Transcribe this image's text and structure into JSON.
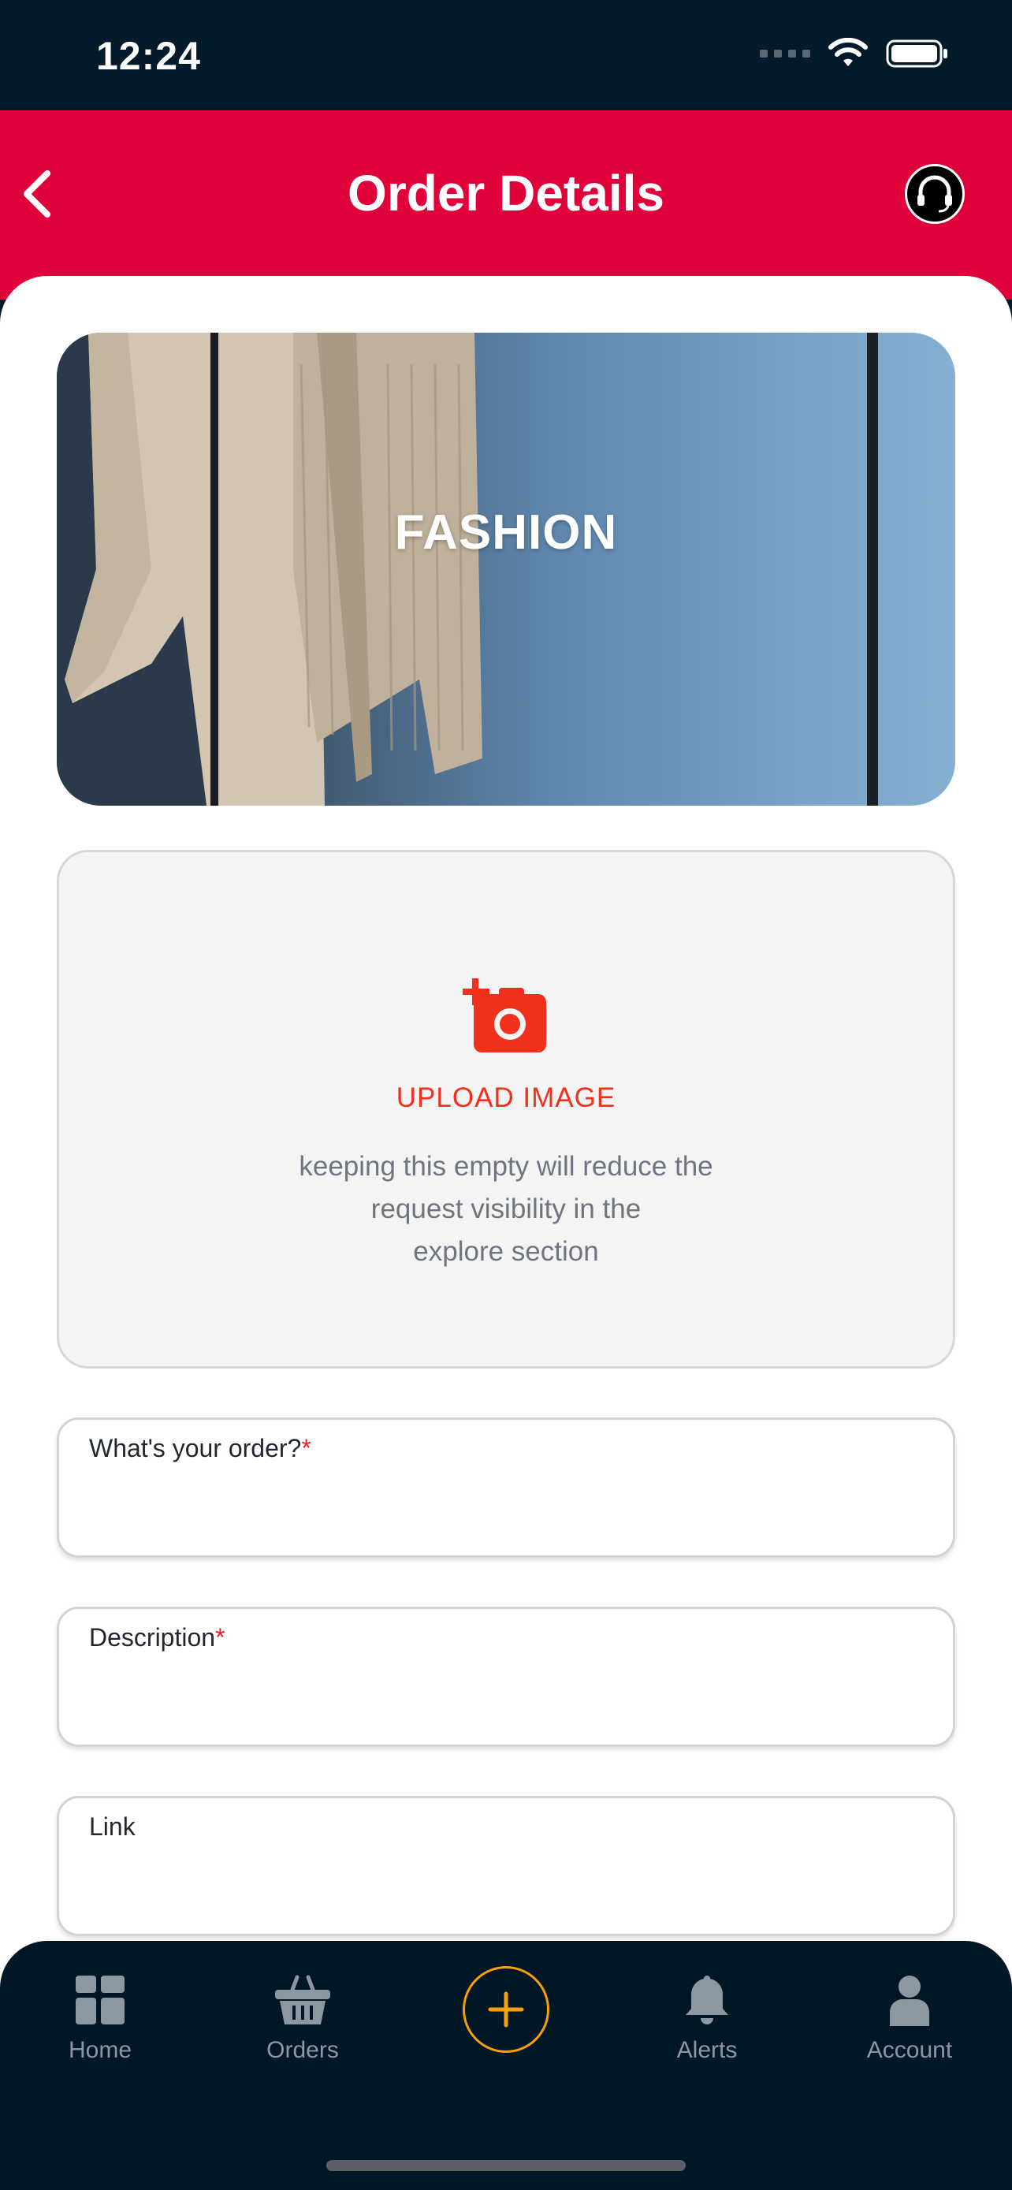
{
  "status_bar": {
    "time": "12:24"
  },
  "header": {
    "title": "Order Details"
  },
  "banner": {
    "title": "FASHION"
  },
  "upload": {
    "label": "UPLOAD IMAGE",
    "hint_lines": [
      "keeping this empty will reduce the",
      "request visibility in the",
      "explore section"
    ]
  },
  "fields": [
    {
      "label": "What's your order?",
      "required_mark": "*"
    },
    {
      "label": "Description",
      "required_mark": "*"
    },
    {
      "label": "Link"
    }
  ],
  "nav": {
    "items": [
      {
        "label": "Home",
        "icon": "grid-icon"
      },
      {
        "label": "Orders",
        "icon": "basket-icon"
      },
      {
        "label": "",
        "icon": "plus-icon"
      },
      {
        "label": "Alerts",
        "icon": "bell-icon"
      },
      {
        "label": "Account",
        "icon": "person-icon"
      }
    ]
  },
  "colors": {
    "header_red": "#e0003a",
    "accent_orange": "#f2311d",
    "nav_bg": "#011726",
    "plus_ring": "#f5a100"
  }
}
